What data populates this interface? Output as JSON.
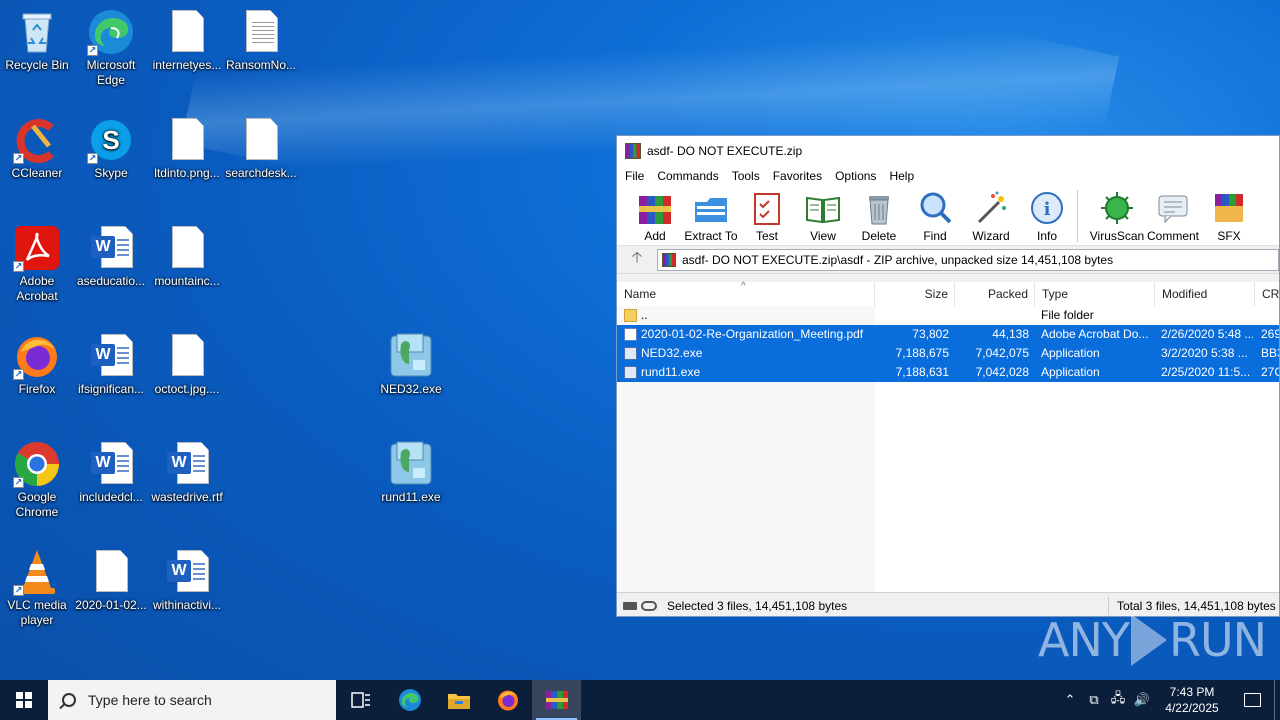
{
  "desktop": {
    "icons": [
      {
        "label": "Recycle Bin"
      },
      {
        "label": "Microsoft Edge"
      },
      {
        "label": "internetyes..."
      },
      {
        "label": "RansomNo..."
      },
      {
        "label": "CCleaner"
      },
      {
        "label": "Skype"
      },
      {
        "label": "ltdinto.png..."
      },
      {
        "label": "searchdesk..."
      },
      {
        "label": "Adobe Acrobat"
      },
      {
        "label": "aseducatio..."
      },
      {
        "label": "mountainc..."
      },
      {
        "label": "Firefox"
      },
      {
        "label": "ifsignifican..."
      },
      {
        "label": "octoct.jpg...."
      },
      {
        "label": "NED32.exe"
      },
      {
        "label": "Google Chrome"
      },
      {
        "label": "includedcl..."
      },
      {
        "label": "wastedrive.rtf"
      },
      {
        "label": "rund11.exe"
      },
      {
        "label": "VLC media player"
      },
      {
        "label": "2020-01-02..."
      },
      {
        "label": "withinactivi..."
      }
    ]
  },
  "winrar": {
    "title": "asdf- DO NOT EXECUTE.zip",
    "menu": [
      "File",
      "Commands",
      "Tools",
      "Favorites",
      "Options",
      "Help"
    ],
    "toolbar": [
      "Add",
      "Extract To",
      "Test",
      "View",
      "Delete",
      "Find",
      "Wizard",
      "Info",
      "VirusScan",
      "Comment",
      "SFX"
    ],
    "address": "asdf- DO NOT EXECUTE.zip\\asdf - ZIP archive, unpacked size 14,451,108 bytes",
    "columns": [
      "Name",
      "Size",
      "Packed",
      "Type",
      "Modified",
      "CRC"
    ],
    "rows": [
      {
        "name": "..",
        "size": "",
        "packed": "",
        "type": "File folder",
        "modified": "",
        "crc": "",
        "icon": "folder-icon",
        "selected": false
      },
      {
        "name": "2020-01-02-Re-Organization_Meeting.pdf",
        "size": "73,802",
        "packed": "44,138",
        "type": "Adobe Acrobat Do...",
        "modified": "2/26/2020 5:48 ...",
        "crc": "269",
        "icon": "pdf-file-icon",
        "selected": true
      },
      {
        "name": "NED32.exe",
        "size": "7,188,675",
        "packed": "7,042,075",
        "type": "Application",
        "modified": "3/2/2020 5:38 ...",
        "crc": "BB3",
        "icon": "exe-file-icon",
        "selected": true
      },
      {
        "name": "rund11.exe",
        "size": "7,188,631",
        "packed": "7,042,028",
        "type": "Application",
        "modified": "2/25/2020 11:5...",
        "crc": "27C",
        "icon": "exe-file-icon",
        "selected": true
      }
    ],
    "status_left": "Selected 3 files, 14,451,108 bytes",
    "status_right": "Total 3 files, 14,451,108 bytes"
  },
  "watermark": {
    "left": "ANY",
    "right": "RUN"
  },
  "taskbar": {
    "search_placeholder": "Type here to search",
    "time": "7:43 PM",
    "date": "4/22/2025"
  }
}
